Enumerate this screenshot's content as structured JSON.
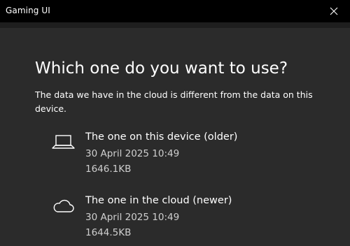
{
  "window": {
    "title": "Gaming UI",
    "close_icon": "close-icon"
  },
  "dialog": {
    "heading": "Which one do you want to use?",
    "description": "The data we have in the cloud is different from the data on this device."
  },
  "options": [
    {
      "icon": "laptop-icon",
      "label": "The one on this device (older)",
      "date": "30 April 2025 10:49",
      "size": "1646.1KB"
    },
    {
      "icon": "cloud-icon",
      "label": "The one in the cloud (newer)",
      "date": "30 April 2025 10:49",
      "size": "1644.5KB"
    }
  ],
  "colors": {
    "titlebar_bg": "#000000",
    "content_bg": "#2b2b2b",
    "text_primary": "#ffffff",
    "text_secondary": "#cfcfcf"
  }
}
